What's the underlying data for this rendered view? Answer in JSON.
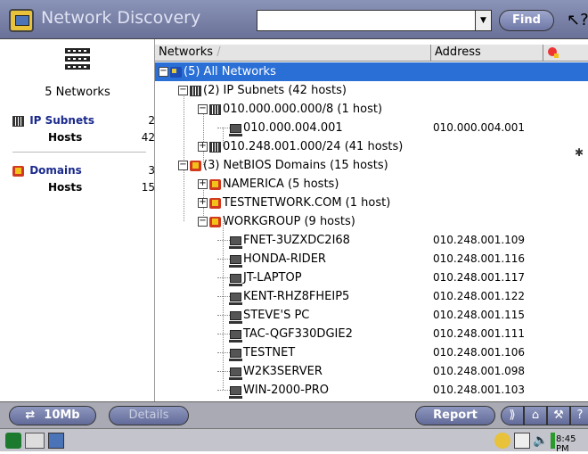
{
  "app": {
    "title": "Network Discovery"
  },
  "search": {
    "value": "",
    "find_label": "Find"
  },
  "left_panel": {
    "count_label": "5 Networks",
    "categories": [
      {
        "label": "IP Subnets",
        "count": "2",
        "sub_label": "Hosts",
        "sub_count": "42"
      },
      {
        "label": "Domains",
        "count": "3",
        "sub_label": "Hosts",
        "sub_count": "15"
      }
    ]
  },
  "columns": {
    "networks": "Networks",
    "sort_mark": "/",
    "address": "Address"
  },
  "tree": [
    {
      "label": "(5) All Networks",
      "address": "",
      "level": 0,
      "expander": "−",
      "icon": "networks-icon",
      "selected": true
    },
    {
      "label": "(2) IP Subnets (42 hosts)",
      "address": "",
      "level": 1,
      "expander": "−",
      "icon": "subnet-icon"
    },
    {
      "label": "010.000.000.000/8 (1 host)",
      "address": "",
      "level": 2,
      "expander": "−",
      "icon": "subnet-icon"
    },
    {
      "label": "010.000.004.001",
      "address": "010.000.004.001",
      "level": 3,
      "expander": "",
      "icon": "host-icon"
    },
    {
      "label": "010.248.001.000/24 (41 hosts)",
      "address": "",
      "level": 2,
      "expander": "+",
      "icon": "subnet-icon"
    },
    {
      "label": "(3) NetBIOS Domains (15 hosts)",
      "address": "",
      "level": 1,
      "expander": "−",
      "icon": "domain-icon"
    },
    {
      "label": "NAMERICA (5 hosts)",
      "address": "",
      "level": 2,
      "expander": "+",
      "icon": "domain-icon"
    },
    {
      "label": "TESTNETWORK.COM (1 host)",
      "address": "",
      "level": 2,
      "expander": "+",
      "icon": "domain-icon"
    },
    {
      "label": "WORKGROUP (9 hosts)",
      "address": "",
      "level": 2,
      "expander": "−",
      "icon": "domain-icon"
    },
    {
      "label": "FNET-3UZXDC2I68",
      "address": "010.248.001.109",
      "level": 3,
      "expander": "",
      "icon": "host-icon"
    },
    {
      "label": "HONDA-RIDER",
      "address": "010.248.001.116",
      "level": 3,
      "expander": "",
      "icon": "host-icon"
    },
    {
      "label": "JT-LAPTOP",
      "address": "010.248.001.117",
      "level": 3,
      "expander": "",
      "icon": "host-icon"
    },
    {
      "label": "KENT-RHZ8FHEIP5",
      "address": "010.248.001.122",
      "level": 3,
      "expander": "",
      "icon": "host-icon"
    },
    {
      "label": "STEVE'S PC",
      "address": "010.248.001.115",
      "level": 3,
      "expander": "",
      "icon": "host-icon"
    },
    {
      "label": "TAC-QGF330DGIE2",
      "address": "010.248.001.111",
      "level": 3,
      "expander": "",
      "icon": "host-icon"
    },
    {
      "label": "TESTNET",
      "address": "010.248.001.106",
      "level": 3,
      "expander": "",
      "icon": "host-icon"
    },
    {
      "label": "W2K3SERVER",
      "address": "010.248.001.098",
      "level": 3,
      "expander": "",
      "icon": "host-icon"
    },
    {
      "label": "WIN-2000-PRO",
      "address": "010.248.001.103",
      "level": 3,
      "expander": "",
      "icon": "host-icon"
    }
  ],
  "toolbar": {
    "speed_label": "10Mb",
    "details_label": "Details",
    "report_label": "Report"
  },
  "status": {
    "clock": "8:45 PM"
  },
  "colors": {
    "selection": "#2a6fd6",
    "title_bar": "#7b83aa"
  }
}
